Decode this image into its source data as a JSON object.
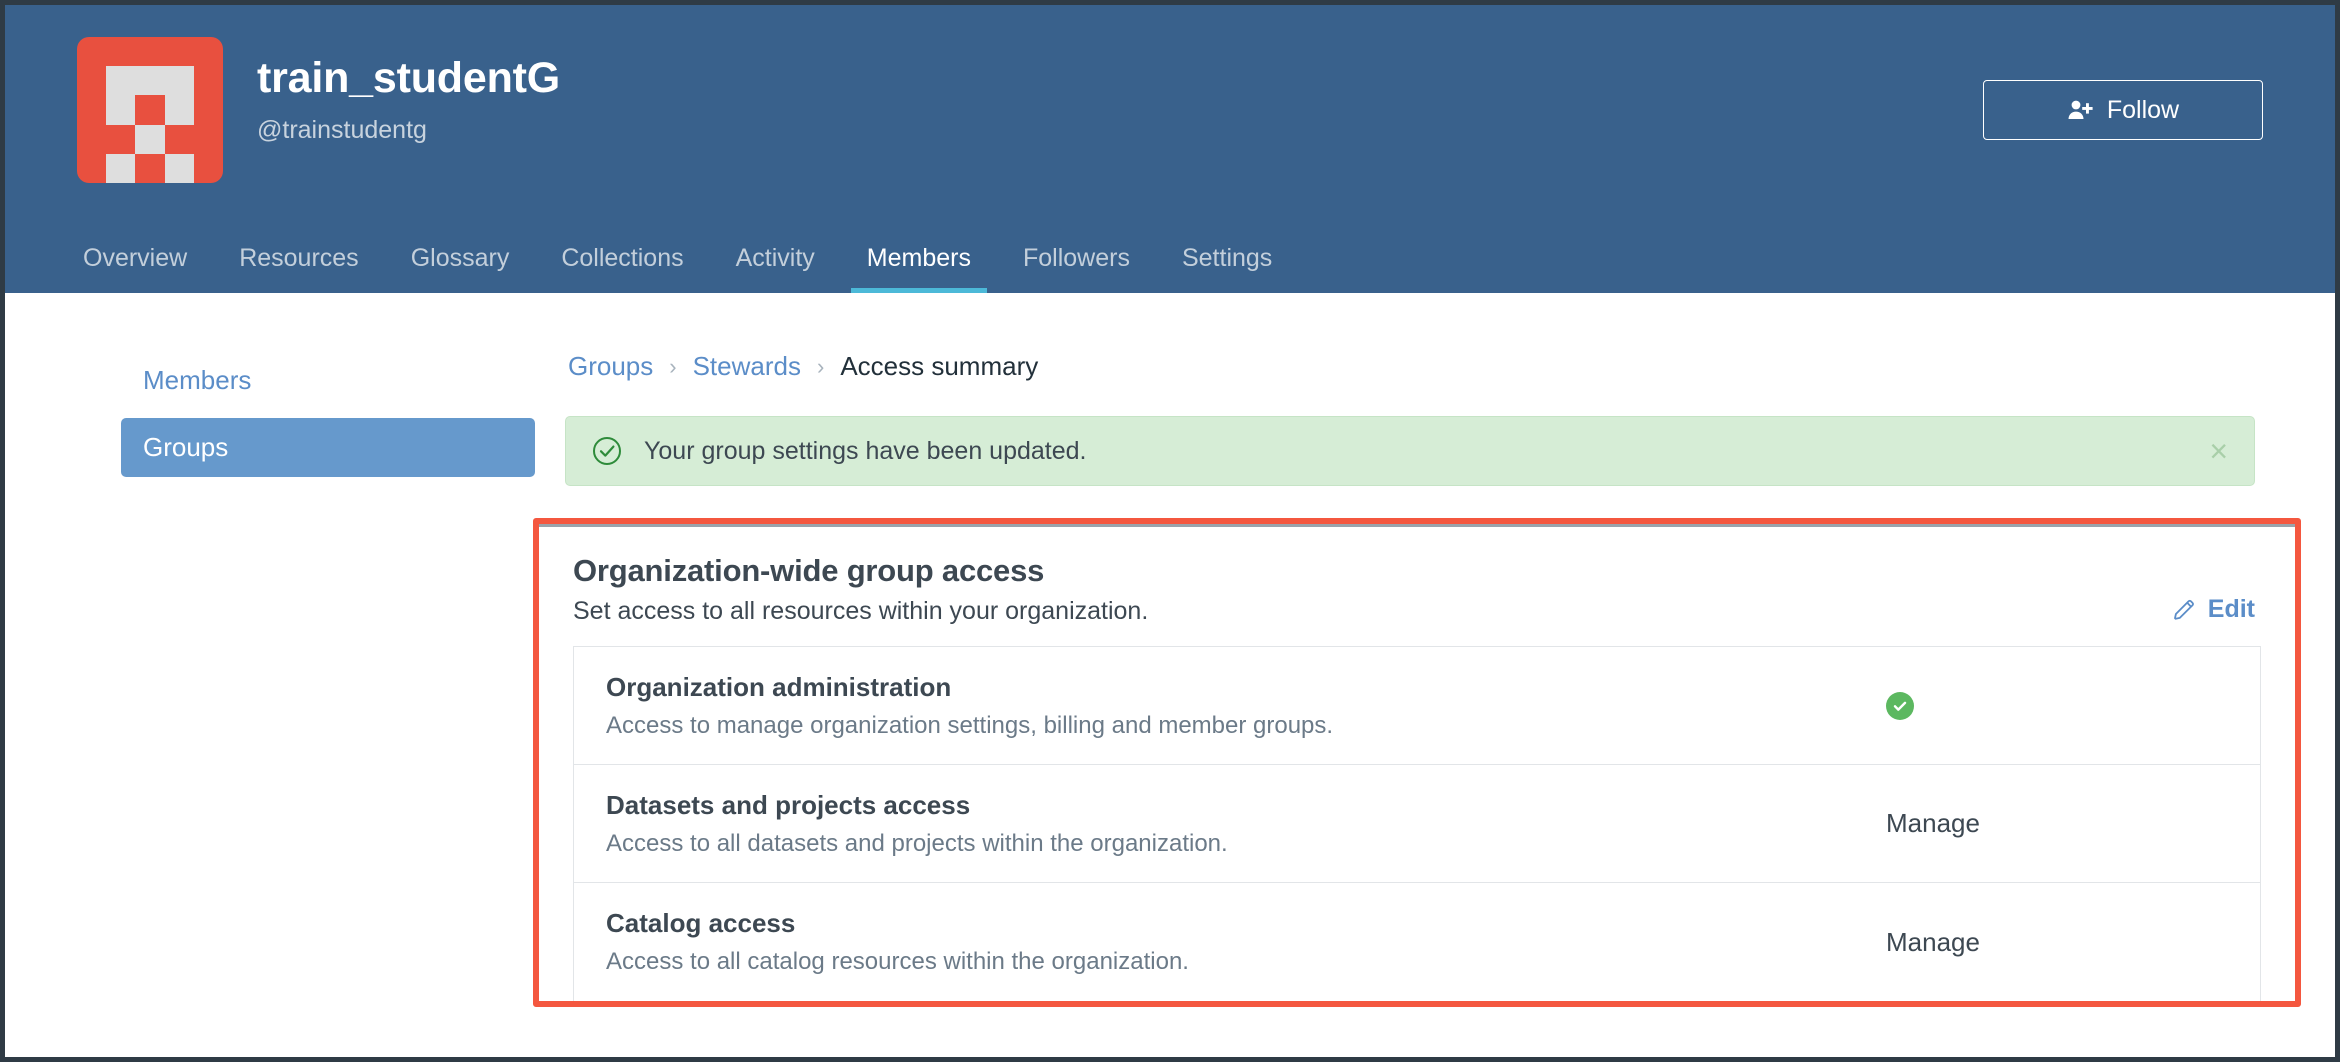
{
  "header": {
    "org_name": "train_studentG",
    "org_handle": "@trainstudentg",
    "avatar_icon": "tableau-logo-icon",
    "follow_label": "Follow",
    "follow_icon": "user-plus-icon",
    "background_color": "#39618c",
    "avatar_color": "#e8503f"
  },
  "nav": {
    "items": [
      {
        "label": "Overview",
        "active": false
      },
      {
        "label": "Resources",
        "active": false
      },
      {
        "label": "Glossary",
        "active": false
      },
      {
        "label": "Collections",
        "active": false
      },
      {
        "label": "Activity",
        "active": false
      },
      {
        "label": "Members",
        "active": true
      },
      {
        "label": "Followers",
        "active": false
      },
      {
        "label": "Settings",
        "active": false
      }
    ],
    "active_underline_color": "#4cb9d8"
  },
  "sidebar": {
    "items": [
      {
        "label": "Members",
        "active": false
      },
      {
        "label": "Groups",
        "active": true
      }
    ],
    "active_color": "#6699cc"
  },
  "breadcrumb": {
    "items": [
      {
        "label": "Groups",
        "current": false
      },
      {
        "label": "Stewards",
        "current": false
      },
      {
        "label": "Access summary",
        "current": true
      }
    ],
    "separator": "›"
  },
  "alert": {
    "message": "Your group settings have been updated.",
    "icon": "check-circle-icon",
    "close_label": "×",
    "background_color": "#d6edd6"
  },
  "panel": {
    "title": "Organization-wide group access",
    "subtitle": "Set access to all resources within your organization.",
    "edit_label": "Edit",
    "edit_icon": "pencil-icon",
    "highlight_color": "#f4573f",
    "rows": [
      {
        "name": "Organization administration",
        "description": "Access to manage organization settings, billing and member groups.",
        "value": "",
        "value_icon": "green-check-badge-icon"
      },
      {
        "name": "Datasets and projects access",
        "description": "Access to all datasets and projects within the organization.",
        "value": "Manage",
        "value_icon": ""
      },
      {
        "name": "Catalog access",
        "description": "Access to all catalog resources within the organization.",
        "value": "Manage",
        "value_icon": ""
      }
    ]
  }
}
